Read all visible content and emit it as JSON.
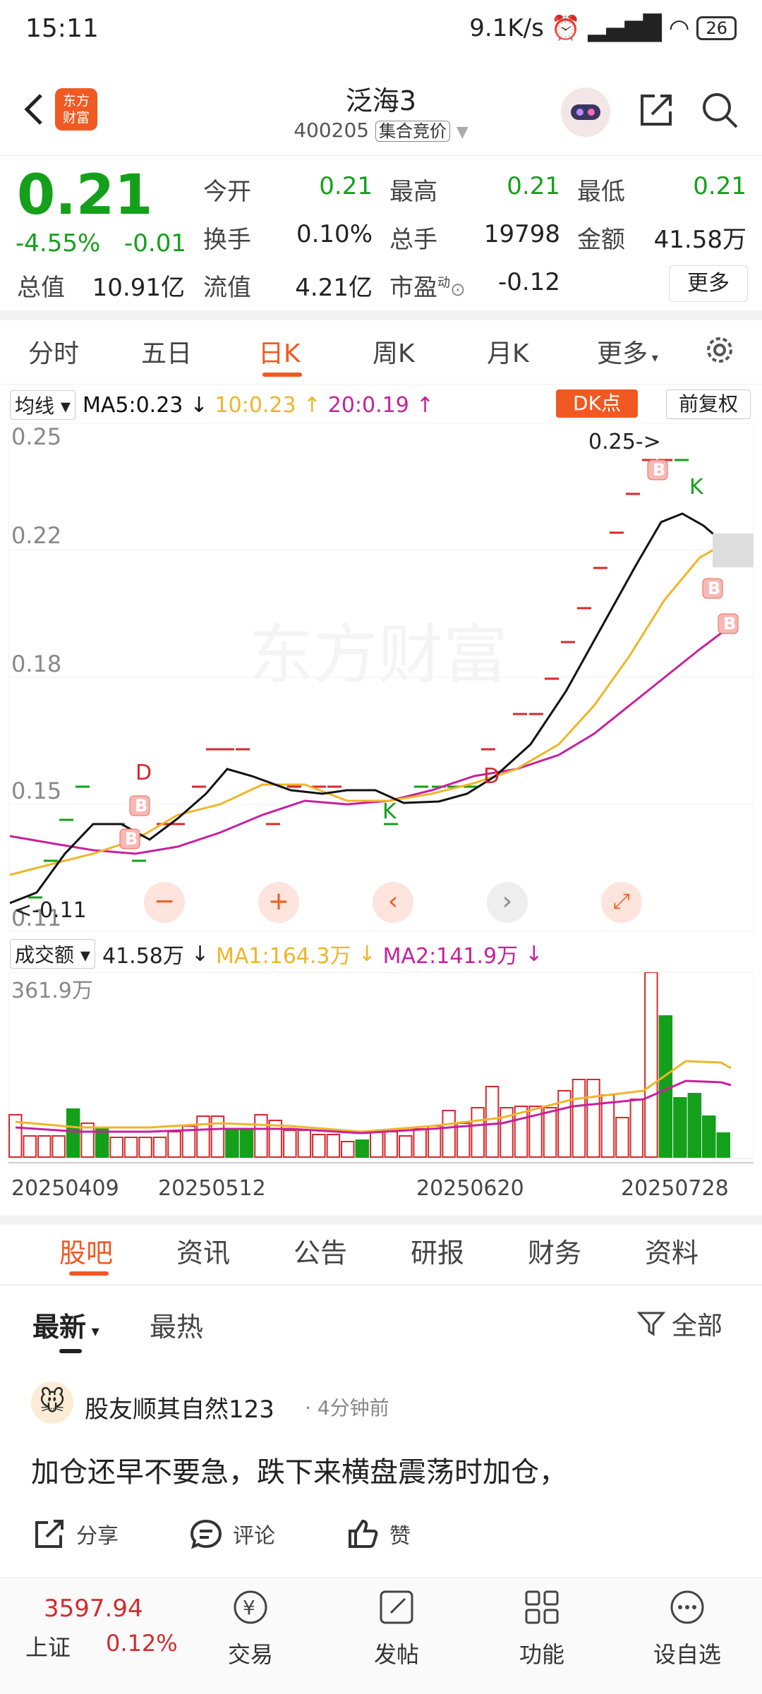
{
  "status": {
    "time": "15:11",
    "net": "9.1K/s",
    "battery": "26"
  },
  "header": {
    "title": "泛海3",
    "code": "400205",
    "badge": "集合竞价",
    "logo_line1": "东方",
    "logo_line2": "财富"
  },
  "quote": {
    "price": "0.21",
    "change_pct": "-4.55%",
    "change": "-0.01",
    "rows": [
      [
        {
          "label": "今开",
          "value": "0.21"
        },
        {
          "label": "最高",
          "value": "0.21"
        },
        {
          "label": "最低",
          "value": "0.21"
        }
      ],
      [
        {
          "label": "换手",
          "value": "0.10%"
        },
        {
          "label": "总手",
          "value": "19798"
        },
        {
          "label": "金额",
          "value": "41.58万"
        }
      ],
      [
        {
          "label": "总值",
          "value": "10.91亿"
        },
        {
          "label": "流值",
          "value": "4.21亿"
        },
        {
          "label": "市盈",
          "value": "-0.12"
        }
      ]
    ],
    "pe_sup": "动",
    "more": "更多"
  },
  "ktabs": [
    "分时",
    "五日",
    "日K",
    "周K",
    "月K",
    "更多"
  ],
  "ma": {
    "select": "均线",
    "ma5": "MA5:0.23",
    "ma10": "10:0.23",
    "ma20": "20:0.19",
    "dk": "DK点",
    "fq": "前复权"
  },
  "chart_labels": {
    "y": [
      "0.25",
      "0.22",
      "0.18",
      "0.15",
      "0.11"
    ],
    "watermark": "东方财富",
    "high": "0.25->",
    "low": "<-0.11"
  },
  "vol": {
    "select": "成交额",
    "amt": "41.58万",
    "ma1": "MA1:164.3万",
    "ma2": "MA2:141.9万",
    "ymax": "361.9万",
    "dates": [
      "20250409",
      "20250512",
      "20250620",
      "20250728"
    ]
  },
  "colors": {
    "up": "#d6292e",
    "down": "#14a01a",
    "ma5": "#111111",
    "ma10": "#f0b528",
    "ma20": "#c8209e",
    "accent": "#f05a22"
  },
  "chart_data": {
    "type": "candlestick",
    "price_ylim": [
      0.11,
      0.25
    ],
    "ma_legend": {
      "ma5": 0.23,
      "ma10": 0.23,
      "ma20": 0.19
    },
    "high": 0.25,
    "low": 0.11,
    "volume_max_wan": 361.9,
    "x_tick_labels": [
      "20250409",
      "20250512",
      "20250620",
      "20250728"
    ]
  },
  "btabs": [
    "股吧",
    "资讯",
    "公告",
    "研报",
    "财务",
    "资料"
  ],
  "filter": {
    "latest": "最新",
    "hot": "最热",
    "all": "全部"
  },
  "post": {
    "user": "股友顺其自然123",
    "time": "· 4分钟前",
    "body": "加仓还早不要急，跌下来横盘震荡时加仓，",
    "share": "分享",
    "comment": "评论",
    "like": "赞"
  },
  "nav": {
    "index_val": "3597.94",
    "index_name": "上证",
    "index_pct": "0.12%",
    "items": [
      "交易",
      "发帖",
      "功能",
      "设自选"
    ]
  }
}
